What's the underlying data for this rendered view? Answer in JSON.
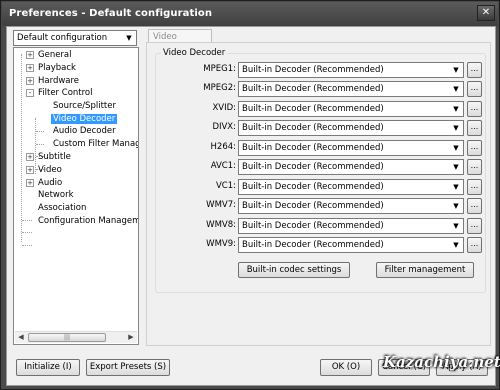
{
  "window": {
    "title": "Preferences - Default configuration"
  },
  "config_selector": {
    "value": "Default configuration"
  },
  "tree": [
    {
      "label": "General",
      "expander": "+"
    },
    {
      "label": "Playback",
      "expander": "+"
    },
    {
      "label": "Hardware",
      "expander": "+"
    },
    {
      "label": "Filter Control",
      "expander": "-"
    },
    {
      "label": "Source/Splitter"
    },
    {
      "label": "Video Decoder",
      "selected": true
    },
    {
      "label": "Audio Decoder"
    },
    {
      "label": "Custom Filter Manager"
    },
    {
      "label": "Subtitle",
      "expander": "+"
    },
    {
      "label": "Video",
      "expander": "+"
    },
    {
      "label": "Audio",
      "expander": "+"
    },
    {
      "label": "Network"
    },
    {
      "label": "Association"
    },
    {
      "label": "Configuration Management"
    }
  ],
  "tab": {
    "label": "Video Decoder"
  },
  "group": {
    "title": "Video Decoder"
  },
  "decoders": [
    {
      "label": "MPEG1:",
      "value": "Built-in Decoder (Recommended)"
    },
    {
      "label": "MPEG2:",
      "value": "Built-in Decoder (Recommended)"
    },
    {
      "label": "XVID:",
      "value": "Built-in Decoder (Recommended)"
    },
    {
      "label": "DIVX:",
      "value": "Built-in Decoder (Recommended)"
    },
    {
      "label": "H264:",
      "value": "Built-in Decoder (Recommended)"
    },
    {
      "label": "AVC1:",
      "value": "Built-in Decoder (Recommended)"
    },
    {
      "label": "VC1:",
      "value": "Built-in Decoder (Recommended)"
    },
    {
      "label": "WMV7:",
      "value": "Built-in Decoder (Recommended)"
    },
    {
      "label": "WMV8:",
      "value": "Built-in Decoder (Recommended)"
    },
    {
      "label": "WMV9:",
      "value": "Built-in Decoder (Recommended)"
    }
  ],
  "dots_label": "...",
  "buttons": {
    "codec_settings": "Built-in codec settings",
    "filter_management": "Filter management",
    "initialize": "Initialize (I)",
    "export_presets": "Export Presets (S)",
    "ok": "OK (O)",
    "cancel": "Cancel (C)",
    "apply": "Apply (A)"
  },
  "watermark": "Kazachiya.net",
  "icons": {
    "close": "close-icon",
    "dropdown": "chevron-down-icon",
    "scroll_left": "arrow-left-icon",
    "scroll_right": "arrow-right-icon"
  }
}
